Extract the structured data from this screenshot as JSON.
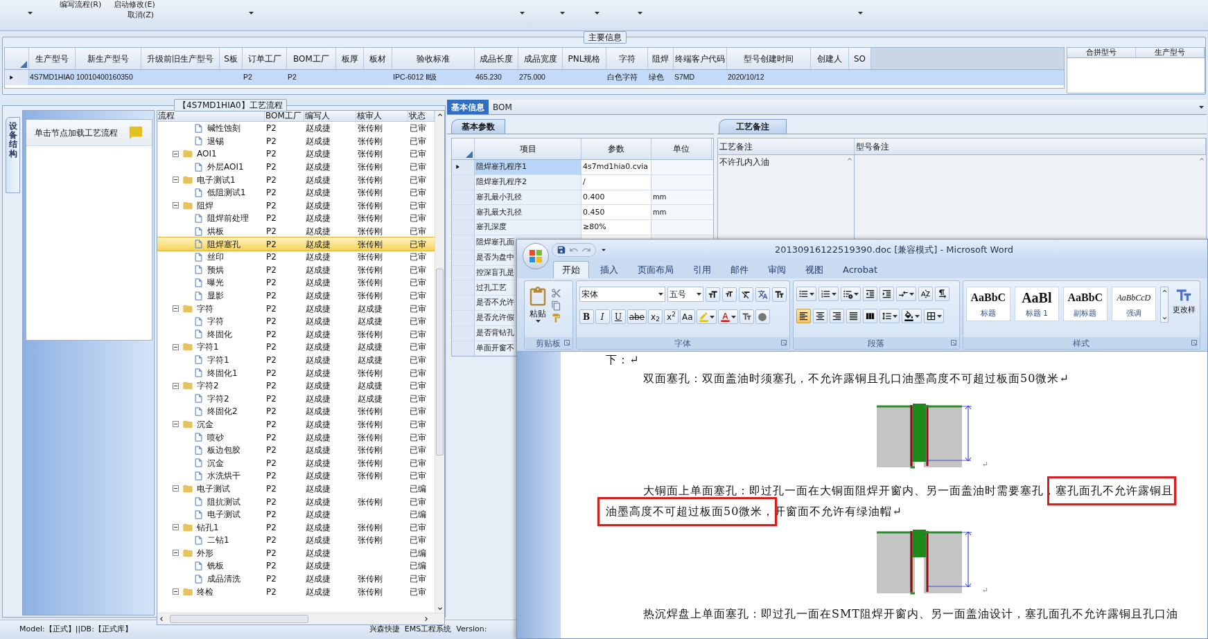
{
  "toolbar": {
    "menu": [
      {
        "label": "编写流程(R)"
      },
      {
        "label": "启动修改(E)"
      },
      {
        "label": "取消(Z)"
      }
    ]
  },
  "main_info": {
    "title": "主要信息",
    "columns": [
      "生产型号",
      "新生产型号",
      "升级前旧生产型号",
      "S板",
      "订单工厂",
      "BOM工厂",
      "板厚",
      "板材",
      "验收标准",
      "成品长度",
      "成品宽度",
      "PNL规格",
      "字符",
      "阻焊",
      "终端客户代码",
      "型号创建时间",
      "创建人",
      "SO"
    ],
    "rows": [
      {
        "selected": true,
        "cells": [
          "4S7MD1HIA0",
          "10010400160350",
          null,
          null,
          "P2",
          "P2",
          null,
          null,
          "IPC-6012 Ⅱ级",
          "465.230",
          "275.000",
          null,
          "白色字符",
          "绿色",
          "S7MD",
          "2020/10/12",
          null,
          null
        ]
      }
    ],
    "side_columns": [
      "合拼型号",
      "生产型号"
    ]
  },
  "process_panel": {
    "title": "【4S7MD1HIA0】工艺流程",
    "side_tab": "设备结构",
    "hint": "单击节点加载工艺流程",
    "columns": [
      "流程",
      "BOM工厂",
      "编写人",
      "核审人",
      "状态"
    ],
    "tree": [
      {
        "children": [
          {
            "label": "碱性蚀刻",
            "bom": "P2",
            "writer": "赵成捷",
            "reviewer": "张传刚",
            "status": "已审",
            "selected": false
          },
          {
            "label": "退锡",
            "bom": "P2",
            "writer": "赵成捷",
            "reviewer": "张传刚",
            "status": "已审",
            "selected": false
          }
        ]
      },
      {
        "label": "AOI1",
        "bom": "P2",
        "writer": "赵成捷",
        "reviewer": "张传刚",
        "status": "已审",
        "selected": false,
        "expanded": true,
        "children": [
          {
            "label": "外层AOI1",
            "bom": "P2",
            "writer": "赵成捷",
            "reviewer": "张传刚",
            "status": "已审",
            "selected": false
          }
        ]
      },
      {
        "label": "电子测试1",
        "bom": "P2",
        "writer": "赵成捷",
        "reviewer": "张传刚",
        "status": "已审",
        "selected": false,
        "expanded": true,
        "children": [
          {
            "label": "低阻测试1",
            "bom": "P2",
            "writer": "赵成捷",
            "reviewer": "张传刚",
            "status": "已审",
            "selected": false
          }
        ]
      },
      {
        "label": "阻焊",
        "bom": "P2",
        "writer": "赵成捷",
        "reviewer": "张传刚",
        "status": "已审",
        "selected": false,
        "expanded": true,
        "children": [
          {
            "label": "阻焊前处理",
            "bom": "P2",
            "writer": "赵成捷",
            "reviewer": "张传刚",
            "status": "已审",
            "selected": false
          },
          {
            "label": "烘板",
            "bom": "P2",
            "writer": "赵成捷",
            "reviewer": "张传刚",
            "status": "已审",
            "selected": false
          },
          {
            "label": "阻焊塞孔",
            "bom": "P2",
            "writer": "赵成捷",
            "reviewer": "张传刚",
            "status": "已审",
            "selected": true
          },
          {
            "label": "丝印",
            "bom": "P2",
            "writer": "赵成捷",
            "reviewer": "张传刚",
            "status": "已审",
            "selected": false
          },
          {
            "label": "预烘",
            "bom": "P2",
            "writer": "赵成捷",
            "reviewer": "张传刚",
            "status": "已审",
            "selected": false
          },
          {
            "label": "曝光",
            "bom": "P2",
            "writer": "赵成捷",
            "reviewer": "张传刚",
            "status": "已审",
            "selected": false
          },
          {
            "label": "显影",
            "bom": "P2",
            "writer": "赵成捷",
            "reviewer": "张传刚",
            "status": "已审",
            "selected": false
          }
        ]
      },
      {
        "label": "字符",
        "bom": "P2",
        "writer": "赵成捷",
        "reviewer": "赵成捷",
        "status": "已审",
        "selected": false,
        "expanded": true,
        "children": [
          {
            "label": "字符",
            "bom": "P2",
            "writer": "赵成捷",
            "reviewer": "赵成捷",
            "status": "已审",
            "selected": false
          },
          {
            "label": "终固化",
            "bom": "P2",
            "writer": "赵成捷",
            "reviewer": "张传刚",
            "status": "已审",
            "selected": false
          }
        ]
      },
      {
        "label": "字符1",
        "bom": "P2",
        "writer": "赵成捷",
        "reviewer": "赵成捷",
        "status": "已审",
        "selected": false,
        "expanded": true,
        "children": [
          {
            "label": "字符1",
            "bom": "P2",
            "writer": "赵成捷",
            "reviewer": "赵成捷",
            "status": "已审",
            "selected": false
          },
          {
            "label": "终固化1",
            "bom": "P2",
            "writer": "赵成捷",
            "reviewer": "张传刚",
            "status": "已审",
            "selected": false
          }
        ]
      },
      {
        "label": "字符2",
        "bom": "P2",
        "writer": "赵成捷",
        "reviewer": "赵成捷",
        "status": "已审",
        "selected": false,
        "expanded": true,
        "children": [
          {
            "label": "字符2",
            "bom": "P2",
            "writer": "赵成捷",
            "reviewer": "赵成捷",
            "status": "已审",
            "selected": false
          },
          {
            "label": "终固化2",
            "bom": "P2",
            "writer": "赵成捷",
            "reviewer": "张传刚",
            "status": "已审",
            "selected": false
          }
        ]
      },
      {
        "label": "沉金",
        "bom": "P2",
        "writer": "赵成捷",
        "reviewer": "张传刚",
        "status": "已审",
        "selected": false,
        "expanded": true,
        "children": [
          {
            "label": "喷砂",
            "bom": "P2",
            "writer": "赵成捷",
            "reviewer": "张传刚",
            "status": "已审",
            "selected": false
          },
          {
            "label": "板边包胶",
            "bom": "P2",
            "writer": "赵成捷",
            "reviewer": "张传刚",
            "status": "已审",
            "selected": false
          },
          {
            "label": "沉金",
            "bom": "P2",
            "writer": "赵成捷",
            "reviewer": "张传刚",
            "status": "已审",
            "selected": false
          },
          {
            "label": "水洗烘干",
            "bom": "P2",
            "writer": "赵成捷",
            "reviewer": "张传刚",
            "status": "已审",
            "selected": false
          }
        ]
      },
      {
        "label": "电子测试",
        "bom": "P2",
        "writer": "赵成捷",
        "status": "已编",
        "selected": false,
        "expanded": true,
        "children": [
          {
            "label": "阻抗测试",
            "bom": "P2",
            "writer": "赵成捷",
            "reviewer": "张传刚",
            "status": "已审",
            "selected": false
          },
          {
            "label": "电子测试",
            "bom": "P2",
            "writer": "赵成捷",
            "status": "已编",
            "selected": false
          }
        ]
      },
      {
        "label": "钻孔1",
        "bom": "P2",
        "writer": "赵成捷",
        "reviewer": "张传刚",
        "status": "已审",
        "selected": false,
        "expanded": true,
        "children": [
          {
            "label": "二钻1",
            "bom": "P2",
            "writer": "赵成捷",
            "reviewer": "张传刚",
            "status": "已审",
            "selected": false
          }
        ]
      },
      {
        "label": "外形",
        "bom": "P2",
        "writer": "赵成捷",
        "status": "已编",
        "selected": false,
        "expanded": true,
        "children": [
          {
            "label": "铣板",
            "bom": "P2",
            "writer": "赵成捷",
            "status": "已编",
            "selected": false
          },
          {
            "label": "成品清洗",
            "bom": "P2",
            "writer": "赵成捷",
            "reviewer": "张传刚",
            "status": "已审",
            "selected": false
          }
        ]
      },
      {
        "label": "终检",
        "bom": "P2",
        "writer": "赵成捷",
        "reviewer": "张传刚",
        "status": "已审",
        "selected": false,
        "expanded": true
      }
    ]
  },
  "detail_panel": {
    "tabs": [
      {
        "label": "基本信息",
        "selected": true
      },
      {
        "label": "BOM",
        "selected": false
      }
    ],
    "params": {
      "tab": "基本参数",
      "columns": [
        "项目",
        "参数",
        "单位"
      ],
      "rows": [
        {
          "item": "阻焊塞孔程序1",
          "value": "4s7md1hia0.cvia",
          "selected": true
        },
        {
          "item": "阻焊塞孔程序2",
          "value": "/",
          "selected": false
        },
        {
          "item": "塞孔最小孔径",
          "value": "0.400",
          "unit": "mm",
          "selected": false
        },
        {
          "item": "塞孔最大孔径",
          "value": "0.450",
          "unit": "mm",
          "selected": false
        },
        {
          "item": "塞孔深度",
          "value": "≥80%",
          "selected": false
        },
        {
          "item": "阻焊塞孔面",
          "selected": false
        },
        {
          "item": "是否为盘中",
          "selected": false
        },
        {
          "item": "控深盲孔是",
          "selected": false
        },
        {
          "item": "过孔工艺",
          "selected": false
        },
        {
          "item": "是否不允许",
          "selected": false
        },
        {
          "item": "是否允许假",
          "selected": false
        },
        {
          "item": "是否背钻孔",
          "selected": false
        },
        {
          "item": "单面开窗不",
          "selected": false
        }
      ]
    },
    "notes": {
      "tab": "工艺备注",
      "columns": [
        "工艺备注",
        "型号备注"
      ],
      "process_note": "不许孔内入油"
    }
  },
  "word": {
    "title": "20130916122519390.doc [兼容模式] - Microsoft Word",
    "tabs": [
      {
        "label": "开始",
        "selected": true
      },
      {
        "label": "插入",
        "selected": false
      },
      {
        "label": "页面布局",
        "selected": false
      },
      {
        "label": "引用",
        "selected": false
      },
      {
        "label": "邮件",
        "selected": false
      },
      {
        "label": "审阅",
        "selected": false
      },
      {
        "label": "视图",
        "selected": false
      },
      {
        "label": "Acrobat",
        "selected": false
      }
    ],
    "clipboard": {
      "paste": "粘贴",
      "group": "剪贴板"
    },
    "font": {
      "name": "宋体",
      "size": "五号",
      "group": "字体",
      "buttons": [
        {
          "kind": "bold",
          "label": "B"
        },
        {
          "kind": "italic",
          "label": "I"
        },
        {
          "kind": "underline",
          "label": "U"
        },
        {
          "kind": "strike",
          "label": "abe"
        },
        {
          "kind": "plain",
          "label": "x$_{2}$"
        },
        {
          "kind": "plain",
          "label": "x$^{2}$"
        },
        {
          "kind": "plain",
          "label": "Aa"
        }
      ]
    },
    "paragraph": {
      "group": "段落",
      "align": [
        {
          "kind": "left",
          "selected": true
        },
        {
          "kind": "center",
          "selected": false
        },
        {
          "kind": "right",
          "selected": false
        },
        {
          "kind": "justify",
          "selected": false
        },
        {
          "kind": "distributed",
          "selected": false
        }
      ]
    },
    "styles": {
      "group": "样式",
      "change": "更改样",
      "items": [
        {
          "kind": "heading",
          "preview": "AaBbC",
          "name": "标题"
        },
        {
          "kind": "heading1",
          "preview": "AaBl",
          "name": "标题 1"
        },
        {
          "kind": "subtitle",
          "preview": "AaBbC",
          "name": "副标题"
        },
        {
          "kind": "emphasis",
          "preview": "AaBbCcD",
          "name": "强调"
        }
      ]
    },
    "document": {
      "blocks": [
        {
          "kind": "text",
          "indent": false,
          "lines": [
            [
              {
                "text": "下：↵"
              }
            ]
          ]
        },
        {
          "kind": "text",
          "indent": true,
          "lines": [
            [
              {
                "text": "双面塞孔：双面盖油时须塞孔，不允许露铜且孔口油墨高度不可超过板面50微米↵"
              }
            ]
          ]
        },
        {
          "kind": "full_figure",
          "mark": "↵"
        },
        {
          "kind": "text",
          "indent": true,
          "lines": [
            [
              {
                "text": "大铜面上单面塞孔：即过孔一面在大铜面阻焊开窗内、另一面盖油时需要塞孔，"
              },
              {
                "text": "塞孔面孔不允许露铜且",
                "boxed": true
              }
            ],
            [
              {
                "text": "油墨高度不可超过板面50微米，",
                "boxed": true
              },
              {
                "text": "开窗面不允许有绿油帽↵"
              }
            ]
          ]
        },
        {
          "kind": "partial_figure",
          "mark": "↵"
        },
        {
          "kind": "text",
          "indent": true,
          "lines": [
            [
              {
                "text": "热沉焊盘上单面塞孔：即过孔一面在SMT阻焊开窗内、另一面盖油设计，塞孔面孔不允许露铜且孔口油"
              }
            ]
          ]
        }
      ]
    }
  },
  "status_bar": {
    "left": "Model:【正式】||DB:【正式库】",
    "right": "兴森快捷  EMS工程系统  Version:"
  }
}
